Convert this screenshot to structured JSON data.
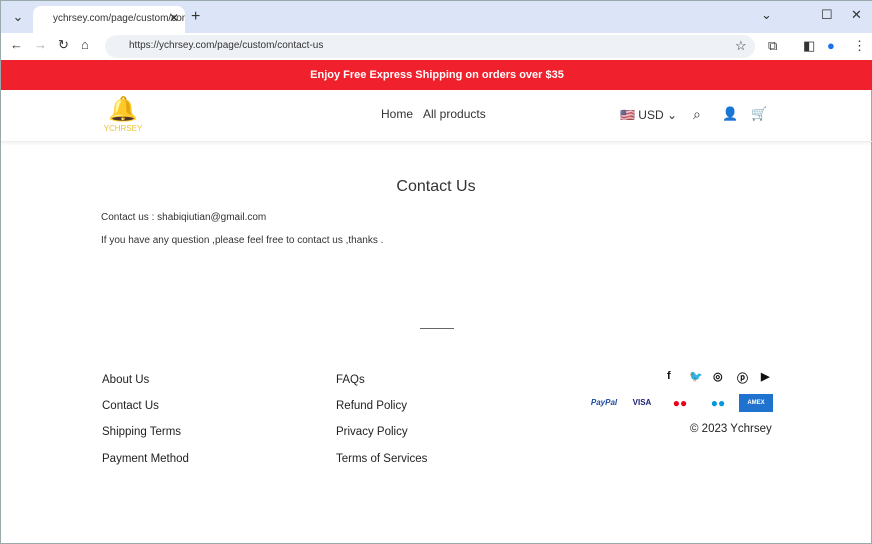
{
  "browser": {
    "tab_title": "ychrsey.com/page/custom/contact-us",
    "url": "https://ychrsey.com/page/custom/contact-us"
  },
  "banner": "Enjoy Free Express Shipping on orders over $35",
  "header": {
    "logo_text": "YCHRSEY",
    "nav": [
      "Home",
      "All products"
    ],
    "currency": "USD"
  },
  "main": {
    "title": "Contact Us",
    "contact_label": "Contact us :",
    "email": "shabiqiutian@gmail.com",
    "message": "If you have any question ,please feel free to contact us ,thanks ."
  },
  "footer": {
    "col1": [
      "About Us",
      "Contact Us",
      "Shipping Terms",
      "Payment Method"
    ],
    "col2": [
      "FAQs",
      "Refund Policy",
      "Privacy Policy",
      "Terms of Services"
    ],
    "social": [
      "facebook",
      "twitter",
      "instagram",
      "pinterest",
      "youtube"
    ],
    "payments": [
      "PayPal",
      "VISA",
      "Mastercard",
      "Maestro",
      "American Express"
    ],
    "copyright": "© 2023 Ychrsey"
  },
  "colors": {
    "banner": "#f0202c",
    "logo": "#e8c23a"
  }
}
